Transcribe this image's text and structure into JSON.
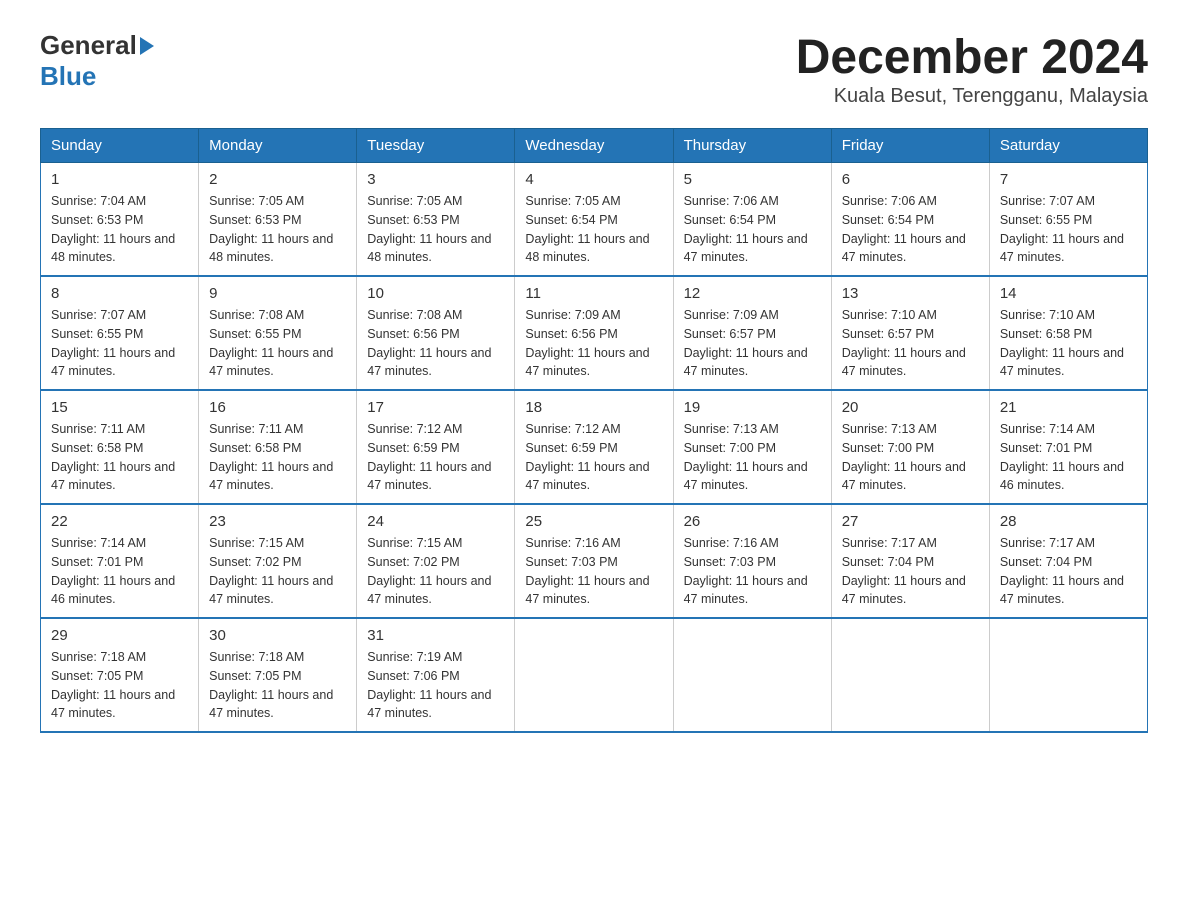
{
  "header": {
    "logo_general": "General",
    "logo_blue": "Blue",
    "title": "December 2024",
    "subtitle": "Kuala Besut, Terengganu, Malaysia"
  },
  "weekdays": [
    "Sunday",
    "Monday",
    "Tuesday",
    "Wednesday",
    "Thursday",
    "Friday",
    "Saturday"
  ],
  "weeks": [
    [
      {
        "day": "1",
        "sunrise": "7:04 AM",
        "sunset": "6:53 PM",
        "daylight": "11 hours and 48 minutes."
      },
      {
        "day": "2",
        "sunrise": "7:05 AM",
        "sunset": "6:53 PM",
        "daylight": "11 hours and 48 minutes."
      },
      {
        "day": "3",
        "sunrise": "7:05 AM",
        "sunset": "6:53 PM",
        "daylight": "11 hours and 48 minutes."
      },
      {
        "day": "4",
        "sunrise": "7:05 AM",
        "sunset": "6:54 PM",
        "daylight": "11 hours and 48 minutes."
      },
      {
        "day": "5",
        "sunrise": "7:06 AM",
        "sunset": "6:54 PM",
        "daylight": "11 hours and 47 minutes."
      },
      {
        "day": "6",
        "sunrise": "7:06 AM",
        "sunset": "6:54 PM",
        "daylight": "11 hours and 47 minutes."
      },
      {
        "day": "7",
        "sunrise": "7:07 AM",
        "sunset": "6:55 PM",
        "daylight": "11 hours and 47 minutes."
      }
    ],
    [
      {
        "day": "8",
        "sunrise": "7:07 AM",
        "sunset": "6:55 PM",
        "daylight": "11 hours and 47 minutes."
      },
      {
        "day": "9",
        "sunrise": "7:08 AM",
        "sunset": "6:55 PM",
        "daylight": "11 hours and 47 minutes."
      },
      {
        "day": "10",
        "sunrise": "7:08 AM",
        "sunset": "6:56 PM",
        "daylight": "11 hours and 47 minutes."
      },
      {
        "day": "11",
        "sunrise": "7:09 AM",
        "sunset": "6:56 PM",
        "daylight": "11 hours and 47 minutes."
      },
      {
        "day": "12",
        "sunrise": "7:09 AM",
        "sunset": "6:57 PM",
        "daylight": "11 hours and 47 minutes."
      },
      {
        "day": "13",
        "sunrise": "7:10 AM",
        "sunset": "6:57 PM",
        "daylight": "11 hours and 47 minutes."
      },
      {
        "day": "14",
        "sunrise": "7:10 AM",
        "sunset": "6:58 PM",
        "daylight": "11 hours and 47 minutes."
      }
    ],
    [
      {
        "day": "15",
        "sunrise": "7:11 AM",
        "sunset": "6:58 PM",
        "daylight": "11 hours and 47 minutes."
      },
      {
        "day": "16",
        "sunrise": "7:11 AM",
        "sunset": "6:58 PM",
        "daylight": "11 hours and 47 minutes."
      },
      {
        "day": "17",
        "sunrise": "7:12 AM",
        "sunset": "6:59 PM",
        "daylight": "11 hours and 47 minutes."
      },
      {
        "day": "18",
        "sunrise": "7:12 AM",
        "sunset": "6:59 PM",
        "daylight": "11 hours and 47 minutes."
      },
      {
        "day": "19",
        "sunrise": "7:13 AM",
        "sunset": "7:00 PM",
        "daylight": "11 hours and 47 minutes."
      },
      {
        "day": "20",
        "sunrise": "7:13 AM",
        "sunset": "7:00 PM",
        "daylight": "11 hours and 47 minutes."
      },
      {
        "day": "21",
        "sunrise": "7:14 AM",
        "sunset": "7:01 PM",
        "daylight": "11 hours and 46 minutes."
      }
    ],
    [
      {
        "day": "22",
        "sunrise": "7:14 AM",
        "sunset": "7:01 PM",
        "daylight": "11 hours and 46 minutes."
      },
      {
        "day": "23",
        "sunrise": "7:15 AM",
        "sunset": "7:02 PM",
        "daylight": "11 hours and 47 minutes."
      },
      {
        "day": "24",
        "sunrise": "7:15 AM",
        "sunset": "7:02 PM",
        "daylight": "11 hours and 47 minutes."
      },
      {
        "day": "25",
        "sunrise": "7:16 AM",
        "sunset": "7:03 PM",
        "daylight": "11 hours and 47 minutes."
      },
      {
        "day": "26",
        "sunrise": "7:16 AM",
        "sunset": "7:03 PM",
        "daylight": "11 hours and 47 minutes."
      },
      {
        "day": "27",
        "sunrise": "7:17 AM",
        "sunset": "7:04 PM",
        "daylight": "11 hours and 47 minutes."
      },
      {
        "day": "28",
        "sunrise": "7:17 AM",
        "sunset": "7:04 PM",
        "daylight": "11 hours and 47 minutes."
      }
    ],
    [
      {
        "day": "29",
        "sunrise": "7:18 AM",
        "sunset": "7:05 PM",
        "daylight": "11 hours and 47 minutes."
      },
      {
        "day": "30",
        "sunrise": "7:18 AM",
        "sunset": "7:05 PM",
        "daylight": "11 hours and 47 minutes."
      },
      {
        "day": "31",
        "sunrise": "7:19 AM",
        "sunset": "7:06 PM",
        "daylight": "11 hours and 47 minutes."
      },
      null,
      null,
      null,
      null
    ]
  ]
}
